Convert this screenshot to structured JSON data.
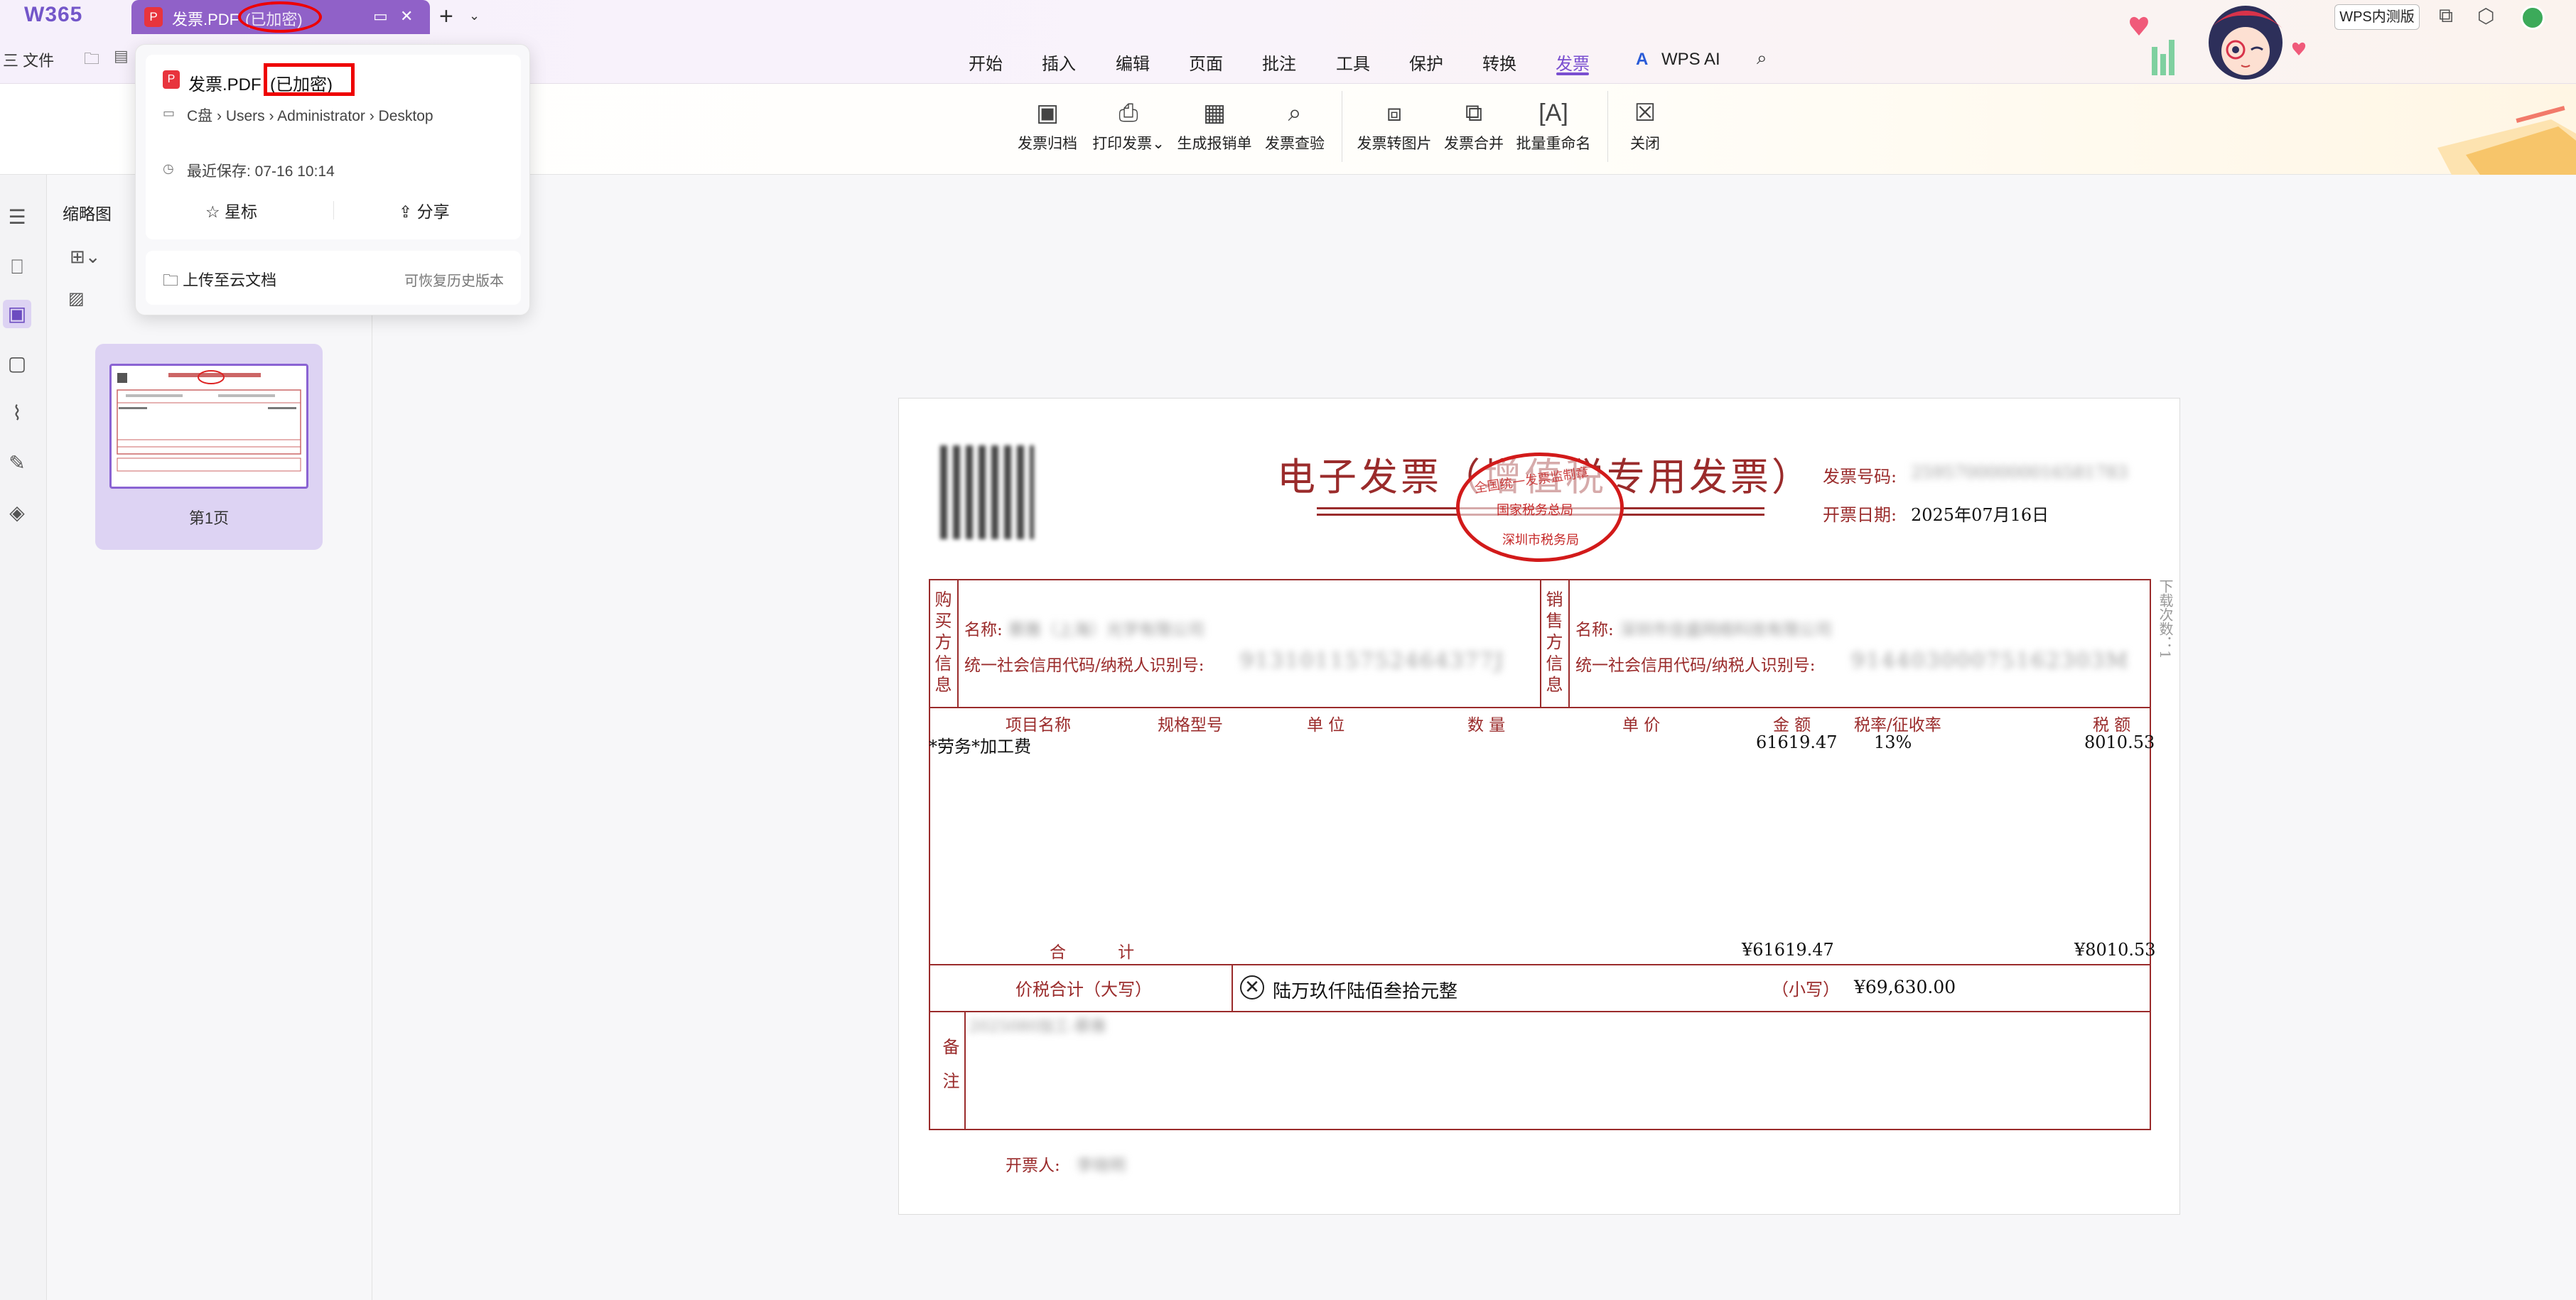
{
  "app": {
    "logo": "W365",
    "tab": {
      "pdf_icon": "pdf-icon",
      "title": "发票.PDF",
      "encrypted": "(已加密)"
    },
    "file_menu": "三 文件",
    "menu_tabs": [
      "开始",
      "插入",
      "编辑",
      "页面",
      "批注",
      "工具",
      "保护",
      "转换",
      "发票"
    ],
    "active_tab": "发票",
    "wps_ai": "WPS AI",
    "beta_badge": "WPS内测版",
    "accent_color": "#7a4fd0",
    "highlight_color": "#ee0000"
  },
  "ribbon": {
    "buttons": [
      "发票归档",
      "打印发票",
      "生成报销单",
      "发票查验",
      "发票转图片",
      "发票合并",
      "批量重命名",
      "关闭"
    ],
    "print_dropdown": "⌄"
  },
  "thumbnails": {
    "title": "缩略图",
    "page_label": "第1页"
  },
  "popup": {
    "file_name": "发票.PDF",
    "encrypted": "(已加密)",
    "path": "C盘 › Users › Administrator › Desktop",
    "last_saved": "最近保存: 07-16 10:14",
    "star": "星标",
    "share": "分享",
    "upload": "上传至云文档",
    "history": "可恢复历史版本"
  },
  "invoice": {
    "title": "电子发票（增值税专用发票）",
    "stamp_top": "全国统一发票监制章",
    "stamp_mid": "国家税务总局",
    "stamp_bottom": "深圳市税务局",
    "invoice_no_label": "发票号码:",
    "invoice_no_value": "25957000000016581783",
    "date_label": "开票日期:",
    "date_value": "2025年07月16日",
    "side_note": "下载次数：1",
    "buyer_label": "购买方信息",
    "seller_label": "销售方信息",
    "name_label": "名称:",
    "buyer_name": "蔡雅（上海）光学有限公司",
    "seller_name": "深圳市佳盛网络科技有限公司",
    "credit_label": "统一社会信用代码/纳税人识别号:",
    "buyer_credit": "91310115752464377J",
    "seller_credit": "91440300075162303M",
    "columns": [
      "项目名称",
      "规格型号",
      "单  位",
      "数  量",
      "单  价",
      "金  额",
      "税率/征收率",
      "税  额"
    ],
    "items": [
      {
        "name": "*劳务*加工费",
        "amount": "61619.47",
        "rate": "13%",
        "tax": "8010.53"
      }
    ],
    "total_label": "合          计",
    "total_amount": "¥61619.47",
    "total_tax": "¥8010.53",
    "grand_label": "价税合计（大写）",
    "grand_words": "陆万玖仟陆佰叁拾元整",
    "small_label": "（小写）",
    "grand_number": "¥69,630.00",
    "remark_label": "备注",
    "remark_value": "2025080加工-蔡雅",
    "issuer_label": "开票人:",
    "issuer_value": "李晓明"
  }
}
